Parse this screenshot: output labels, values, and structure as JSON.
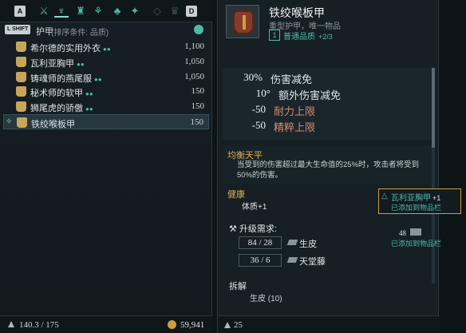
{
  "tabs": {
    "left_key": "A",
    "right_key": "D"
  },
  "sort": {
    "shift_key": "L SHIFT",
    "category": "护甲",
    "hint": "(排序条件: 品质)"
  },
  "items": [
    {
      "name": "希尔德的实用外衣",
      "dots": "●●",
      "value": "1,100"
    },
    {
      "name": "瓦利亚胸甲",
      "dots": "●●",
      "value": "1,050"
    },
    {
      "name": "铸魂师的燕尾服",
      "dots": "●●",
      "value": "1,050"
    },
    {
      "name": "秘术师的软甲",
      "dots": "●●",
      "value": "150"
    },
    {
      "name": "狮尾虎的骄傲",
      "dots": "●●",
      "value": "150"
    },
    {
      "name": "铁绞喉板甲",
      "dots": "",
      "value": "150"
    }
  ],
  "footer": {
    "weight": "140.3 / 175",
    "gold": "59,941"
  },
  "detail": {
    "title": "铁绞喉板甲",
    "subtitle": "重型护甲，唯一物品",
    "quality_level": "1",
    "quality": "普通品质",
    "quality_count": "+2/3",
    "stats": [
      {
        "value": "30%",
        "label": "伤害减免"
      },
      {
        "value": "10°",
        "label": "额外伤害减免"
      },
      {
        "value": "-50",
        "label": "耐力上限"
      },
      {
        "value": "-50",
        "label": "精粹上限"
      }
    ],
    "trait_title": "均衡天平",
    "trait_desc": "当受到的伤害超过最大生命值的25%时，攻击者将受到50%的伤害。",
    "health_title": "健康",
    "health_value": "体质+1",
    "upgrade_title": "升级需求:",
    "materials": [
      {
        "count": "84 / 28",
        "name": "生皮"
      },
      {
        "count": "36 / 6",
        "name": "天堂藤"
      }
    ],
    "dismantle_title": "拆解",
    "dismantle_mat": "生皮 (10)",
    "weight": "25"
  },
  "notifications": {
    "first_name": "瓦利亚胸甲",
    "first_qty": "+1",
    "first_text": "已添加到物品栏",
    "second_count": "48",
    "second_text": "已添加到物品栏"
  },
  "colors": {
    "accent": "#4fb8a6",
    "gold": "#e2b052",
    "warn": "#d88a72"
  }
}
